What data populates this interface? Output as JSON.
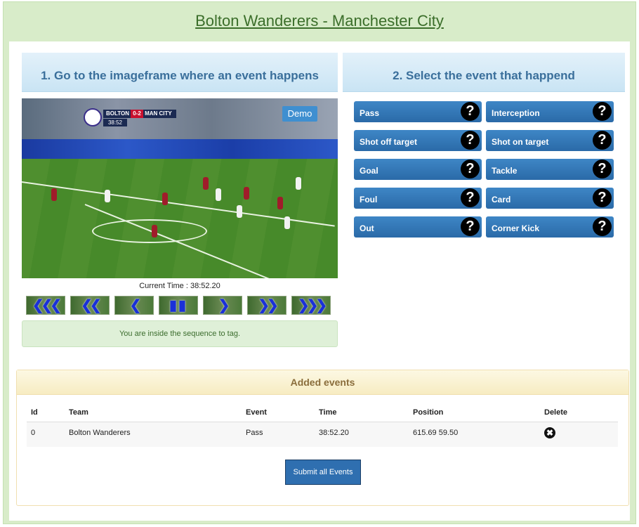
{
  "page": {
    "title": "Bolton Wanderers - Manchester City"
  },
  "step1": {
    "heading": "1. Go to the imageframe where an event happens"
  },
  "step2": {
    "heading": "2. Select the event that happend"
  },
  "video": {
    "scoreboard": {
      "home": "BOLTON",
      "score": "0-2",
      "away": "MAN CITY",
      "time": "38:52"
    },
    "demo_label": "Demo"
  },
  "current_time": {
    "label": "Current Time : 38:52.20"
  },
  "controls": [
    {
      "name": "rewind-fast-button",
      "glyph": "❮❮❮"
    },
    {
      "name": "rewind-button",
      "glyph": "❮❮"
    },
    {
      "name": "step-back-button",
      "glyph": "❮"
    },
    {
      "name": "pause-button",
      "glyph": "▮▮"
    },
    {
      "name": "step-forward-button",
      "glyph": "❯"
    },
    {
      "name": "forward-button",
      "glyph": "❯❯"
    },
    {
      "name": "forward-fast-button",
      "glyph": "❯❯❯"
    }
  ],
  "notice": {
    "text": "You are inside the sequence to tag."
  },
  "events": [
    {
      "label": "Pass",
      "help": "?"
    },
    {
      "label": "Interception",
      "help": "?"
    },
    {
      "label": "Shot off target",
      "help": "?"
    },
    {
      "label": "Shot on target",
      "help": "?"
    },
    {
      "label": "Goal",
      "help": "?"
    },
    {
      "label": "Tackle",
      "help": "?"
    },
    {
      "label": "Foul",
      "help": "?"
    },
    {
      "label": "Card",
      "help": "?"
    },
    {
      "label": "Out",
      "help": "?"
    },
    {
      "label": "Corner Kick",
      "help": "?"
    }
  ],
  "added_events": {
    "heading": "Added events",
    "columns": [
      "Id",
      "Team",
      "Event",
      "Time",
      "Position",
      "Delete"
    ],
    "rows": [
      {
        "id": "0",
        "team": "Bolton Wanderers",
        "event": "Pass",
        "time": "38:52.20",
        "position": "615.69 59.50",
        "delete": "✖"
      }
    ],
    "submit_label": "Submit all Events"
  },
  "colors": {
    "accent": "#2f6fb0",
    "frame": "#d8ecc9",
    "title": "#3b6e2a"
  }
}
